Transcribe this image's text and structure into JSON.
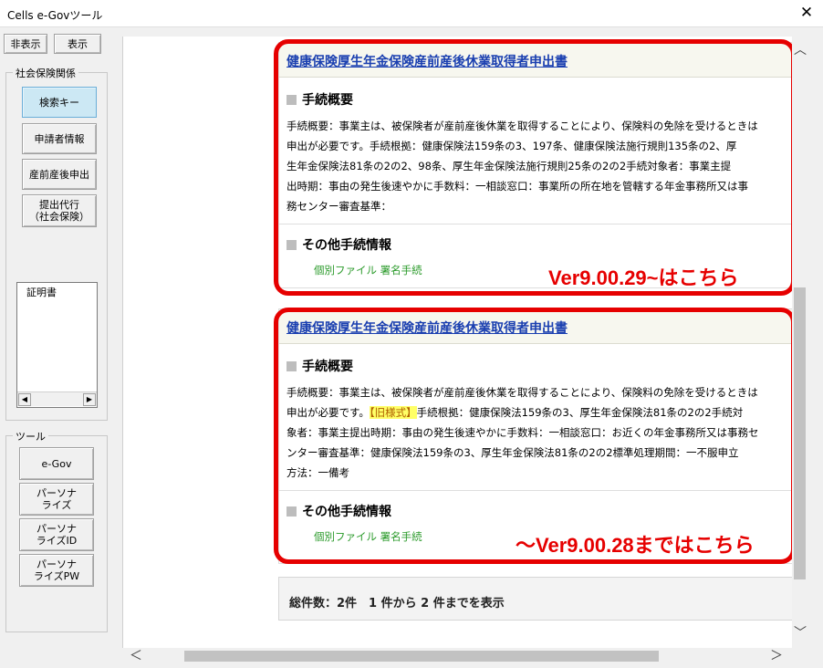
{
  "window": {
    "title": "Cells e-Govツール",
    "close_glyph": "✕"
  },
  "sidebar": {
    "hide_label": "非表示",
    "show_label": "表示",
    "group1_label": "社会保険関係",
    "buttons": [
      {
        "label": "検索キー"
      },
      {
        "label": "申請者情報"
      },
      {
        "label": "産前産後申出"
      },
      {
        "label": "提出代行\n（社会保険）"
      }
    ],
    "list_items": [
      "証明書"
    ],
    "group2_label": "ツール",
    "tools": [
      {
        "label": "e-Gov"
      },
      {
        "label": "パーソナ\nライズ"
      },
      {
        "label": "パーソナ\nライズID"
      },
      {
        "label": "パーソナ\nライズPW"
      }
    ]
  },
  "results": [
    {
      "title": "健康保険厚生年金保険産前産後休業取得者申出書",
      "overview_heading": "手続概要",
      "overview_lines": [
        "手続概要：事業主は、被保険者が産前産後休業を取得することにより、保険料の免除を受けるときは",
        "申出が必要です。手続根拠：健康保険法159条の3、197条、健康保険法施行規則135条の2、厚",
        "生年金保険法81条の2の2、98条、厚生年金保険法施行規則25条の2の2手続対象者：事業主提",
        "出時期：事由の発生後速やかに手数料：一相談窓口：事業所の所在地を管轄する年金事務所又は事",
        "務センター審査基準："
      ],
      "other_heading": "その他手続情報",
      "other_link": "個別ファイル 署名手続",
      "overlay": "Ver9.00.29~はこちら"
    },
    {
      "title": "健康保険厚生年金保険産前産後休業取得者申出書",
      "overview_heading": "手続概要",
      "overview_line1": "手続概要：事業主は、被保険者が産前産後休業を取得することにより、保険料の免除を受けるときは",
      "overview_line2_pre": "申出が必要です。",
      "overview_line2_badge": "【旧様式】",
      "overview_line2_post": "手続根拠：健康保険法159条の3、厚生年金保険法81条の2の2手続対",
      "overview_lines_rest": [
        "象者：事業主提出時期：事由の発生後速やかに手数料：一相談窓口：お近くの年金事務所又は事務セ",
        "ンター審査基準：健康保険法159条の3、厚生年金保険法81条の2の2標準処理期間：一不服申立",
        "方法：一備考"
      ],
      "other_heading": "その他手続情報",
      "other_link": "個別ファイル 署名手続",
      "overlay": "～Ver9.00.28まではこちら"
    }
  ],
  "footer": {
    "summary": "総件数：2件　1 件から 2 件までを表示"
  },
  "scroll": {
    "up": "︿",
    "down": "﹀",
    "left": "＜",
    "right": "＞",
    "small_left": "◀",
    "small_right": "▶"
  }
}
